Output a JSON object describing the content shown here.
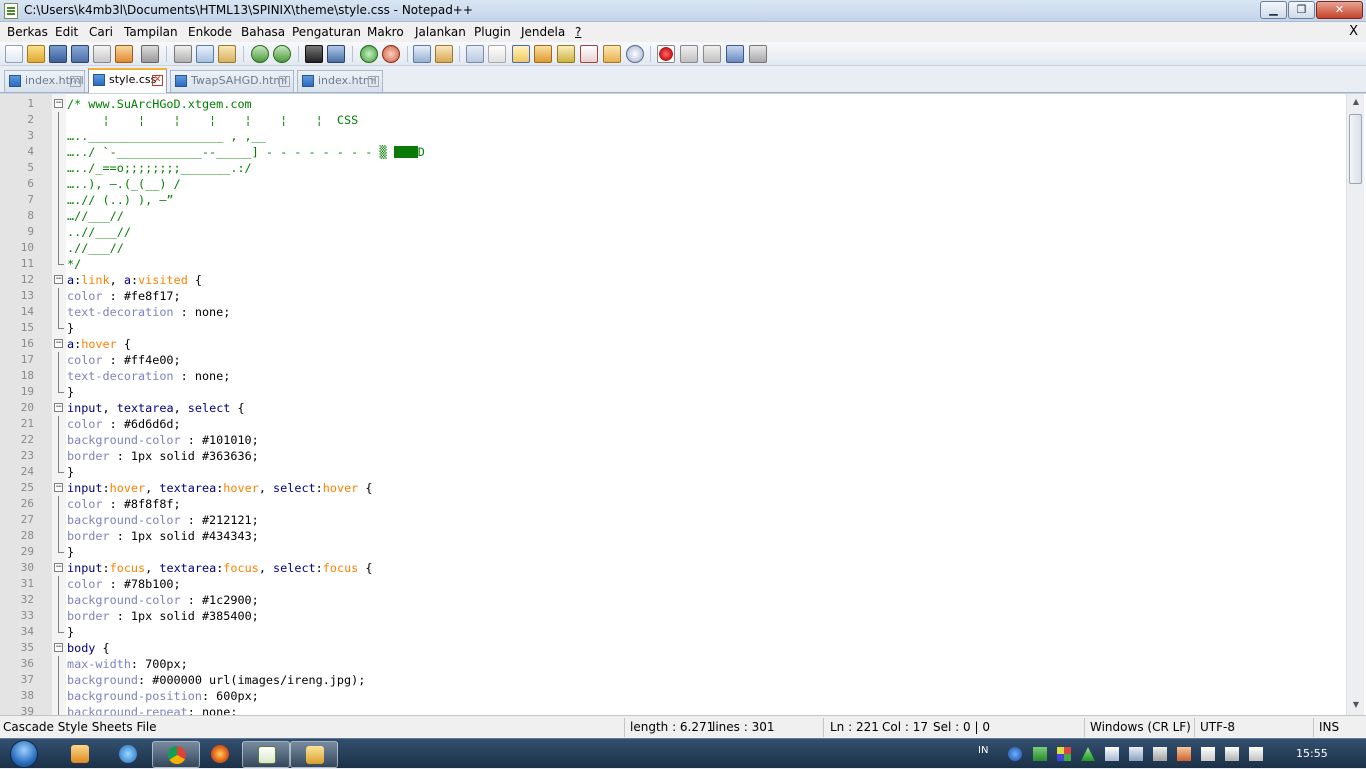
{
  "window": {
    "title": "C:\\Users\\k4mb3l\\Documents\\HTML13\\SPINIX\\theme\\style.css - Notepad++",
    "minimize_label": "▁",
    "maximize_label": "❐",
    "close_label": "✕"
  },
  "menu": {
    "items": [
      "Berkas",
      "Edit",
      "Cari",
      "Tampilan",
      "Enkode",
      "Bahasa",
      "Pengaturan",
      "Makro",
      "Jalankan",
      "Plugin",
      "Jendela",
      "?"
    ],
    "close_doc": "X"
  },
  "tabs": [
    {
      "label": "index.html",
      "active": false
    },
    {
      "label": "style.css",
      "active": true
    },
    {
      "label": "TwapSAHGD.html",
      "active": false
    },
    {
      "label": "index.html",
      "active": false
    }
  ],
  "code_lines": [
    {
      "n": "1",
      "fold": "open",
      "spans": [
        [
          "c-cmt",
          "/* www.SuArcHGoD.xtgem.com"
        ]
      ]
    },
    {
      "n": "2",
      "fold": "line",
      "spans": [
        [
          "c-cmt",
          "     ¦    ¦    ¦    ¦    ¦    ¦    ¦  CSS"
        ]
      ]
    },
    {
      "n": "3",
      "fold": "line",
      "spans": [
        [
          "c-cmt",
          "…..___________________ , ,__"
        ]
      ]
    },
    {
      "n": "4",
      "fold": "line",
      "spans": [
        [
          "c-cmt",
          "…../ `-____________--_____] - - - - - - - - ▒ "
        ],
        [
          "block",
          ""
        ],
        [
          "c-cmt",
          "D"
        ]
      ]
    },
    {
      "n": "5",
      "fold": "line",
      "spans": [
        [
          "c-cmt",
          "…../_==o;;;;;;;;_______.:/"
        ]
      ]
    },
    {
      "n": "6",
      "fold": "line",
      "spans": [
        [
          "c-cmt",
          "…..), —.(_(__) /"
        ]
      ]
    },
    {
      "n": "7",
      "fold": "line",
      "spans": [
        [
          "c-cmt",
          "….// (..) ), —”"
        ]
      ]
    },
    {
      "n": "8",
      "fold": "line",
      "spans": [
        [
          "c-cmt",
          "…//___//"
        ]
      ]
    },
    {
      "n": "9",
      "fold": "line",
      "spans": [
        [
          "c-cmt",
          "..//___//"
        ]
      ]
    },
    {
      "n": "10",
      "fold": "line",
      "spans": [
        [
          "c-cmt",
          ".//___//"
        ]
      ]
    },
    {
      "n": "11",
      "fold": "end",
      "spans": [
        [
          "c-cmt",
          "*/"
        ]
      ]
    },
    {
      "n": "12",
      "fold": "open",
      "spans": [
        [
          "c-sel",
          "a"
        ],
        [
          "c-val",
          ":"
        ],
        [
          "c-pseudo",
          "link"
        ],
        [
          "c-val",
          ", "
        ],
        [
          "c-sel",
          "a"
        ],
        [
          "c-val",
          ":"
        ],
        [
          "c-pseudo",
          "visited"
        ],
        [
          "c-val",
          " {"
        ]
      ]
    },
    {
      "n": "13",
      "fold": "line",
      "spans": [
        [
          "c-prop",
          "color"
        ],
        [
          "c-val",
          " : #fe8f17;"
        ]
      ]
    },
    {
      "n": "14",
      "fold": "line",
      "spans": [
        [
          "c-prop",
          "text-decoration"
        ],
        [
          "c-val",
          " : none;"
        ]
      ]
    },
    {
      "n": "15",
      "fold": "end",
      "spans": [
        [
          "c-val",
          "}"
        ]
      ]
    },
    {
      "n": "16",
      "fold": "open",
      "spans": [
        [
          "c-sel",
          "a"
        ],
        [
          "c-val",
          ":"
        ],
        [
          "c-pseudo",
          "hover"
        ],
        [
          "c-val",
          " {"
        ]
      ]
    },
    {
      "n": "17",
      "fold": "line",
      "spans": [
        [
          "c-prop",
          "color"
        ],
        [
          "c-val",
          " : #ff4e00;"
        ]
      ]
    },
    {
      "n": "18",
      "fold": "line",
      "spans": [
        [
          "c-prop",
          "text-decoration"
        ],
        [
          "c-val",
          " : none;"
        ]
      ]
    },
    {
      "n": "19",
      "fold": "end",
      "spans": [
        [
          "c-val",
          "}"
        ]
      ]
    },
    {
      "n": "20",
      "fold": "open",
      "spans": [
        [
          "c-sel",
          "input"
        ],
        [
          "c-val",
          ", "
        ],
        [
          "c-sel",
          "textarea"
        ],
        [
          "c-val",
          ", "
        ],
        [
          "c-sel",
          "select"
        ],
        [
          "c-val",
          " {"
        ]
      ]
    },
    {
      "n": "21",
      "fold": "line",
      "spans": [
        [
          "c-prop",
          "color"
        ],
        [
          "c-val",
          " : #6d6d6d;"
        ]
      ]
    },
    {
      "n": "22",
      "fold": "line",
      "spans": [
        [
          "c-prop",
          "background-color"
        ],
        [
          "c-val",
          " : #101010;"
        ]
      ]
    },
    {
      "n": "23",
      "fold": "line",
      "spans": [
        [
          "c-prop",
          "border"
        ],
        [
          "c-val",
          " : 1px solid #363636;"
        ]
      ]
    },
    {
      "n": "24",
      "fold": "end",
      "spans": [
        [
          "c-val",
          "}"
        ]
      ]
    },
    {
      "n": "25",
      "fold": "open",
      "spans": [
        [
          "c-sel",
          "input"
        ],
        [
          "c-val",
          ":"
        ],
        [
          "c-pseudo",
          "hover"
        ],
        [
          "c-val",
          ", "
        ],
        [
          "c-sel",
          "textarea"
        ],
        [
          "c-val",
          ":"
        ],
        [
          "c-pseudo",
          "hover"
        ],
        [
          "c-val",
          ", "
        ],
        [
          "c-sel",
          "select"
        ],
        [
          "c-val",
          ":"
        ],
        [
          "c-pseudo",
          "hover"
        ],
        [
          "c-val",
          " {"
        ]
      ]
    },
    {
      "n": "26",
      "fold": "line",
      "spans": [
        [
          "c-prop",
          "color"
        ],
        [
          "c-val",
          " : #8f8f8f;"
        ]
      ]
    },
    {
      "n": "27",
      "fold": "line",
      "spans": [
        [
          "c-prop",
          "background-color"
        ],
        [
          "c-val",
          " : #212121;"
        ]
      ]
    },
    {
      "n": "28",
      "fold": "line",
      "spans": [
        [
          "c-prop",
          "border"
        ],
        [
          "c-val",
          " : 1px solid #434343;"
        ]
      ]
    },
    {
      "n": "29",
      "fold": "end",
      "spans": [
        [
          "c-val",
          "}"
        ]
      ]
    },
    {
      "n": "30",
      "fold": "open",
      "spans": [
        [
          "c-sel",
          "input"
        ],
        [
          "c-val",
          ":"
        ],
        [
          "c-pseudo",
          "focus"
        ],
        [
          "c-val",
          ", "
        ],
        [
          "c-sel",
          "textarea"
        ],
        [
          "c-val",
          ":"
        ],
        [
          "c-pseudo",
          "focus"
        ],
        [
          "c-val",
          ", "
        ],
        [
          "c-sel",
          "select"
        ],
        [
          "c-val",
          ":"
        ],
        [
          "c-pseudo",
          "focus"
        ],
        [
          "c-val",
          " {"
        ]
      ]
    },
    {
      "n": "31",
      "fold": "line",
      "spans": [
        [
          "c-prop",
          "color"
        ],
        [
          "c-val",
          " : #78b100;"
        ]
      ]
    },
    {
      "n": "32",
      "fold": "line",
      "spans": [
        [
          "c-prop",
          "background-color"
        ],
        [
          "c-val",
          " : #1c2900;"
        ]
      ]
    },
    {
      "n": "33",
      "fold": "line",
      "spans": [
        [
          "c-prop",
          "border"
        ],
        [
          "c-val",
          " : 1px solid #385400;"
        ]
      ]
    },
    {
      "n": "34",
      "fold": "end",
      "spans": [
        [
          "c-val",
          "}"
        ]
      ]
    },
    {
      "n": "35",
      "fold": "open",
      "spans": [
        [
          "c-sel",
          "body"
        ],
        [
          "c-val",
          " {"
        ]
      ]
    },
    {
      "n": "36",
      "fold": "line",
      "spans": [
        [
          "c-prop",
          "max-width"
        ],
        [
          "c-val",
          ": 700px;"
        ]
      ]
    },
    {
      "n": "37",
      "fold": "line",
      "spans": [
        [
          "c-prop",
          "background"
        ],
        [
          "c-val",
          ": #000000 url(images/ireng.jpg);"
        ]
      ]
    },
    {
      "n": "38",
      "fold": "line",
      "spans": [
        [
          "c-prop",
          "background-position"
        ],
        [
          "c-val",
          ": 600px;"
        ]
      ]
    },
    {
      "n": "39",
      "fold": "line",
      "spans": [
        [
          "c-prop",
          "background-repeat"
        ],
        [
          "c-val",
          ": none;"
        ]
      ]
    }
  ],
  "status": {
    "file_type": "Cascade Style Sheets File",
    "length": "length : 6.271",
    "lines": "lines : 301",
    "ln": "Ln : 221",
    "col": "Col : 17",
    "sel": "Sel : 0 | 0",
    "eol": "Windows (CR LF)",
    "encoding": "UTF-8",
    "mode": "INS"
  },
  "taskbar": {
    "language": "IN",
    "clock": "15:55"
  },
  "colors": {
    "comment": "#008000",
    "selector": "#000080",
    "pseudo": "#ff8000",
    "property": "#8080c0",
    "highlight_block": "#0a7a0a",
    "active_tab_accent": "#f2b335"
  }
}
